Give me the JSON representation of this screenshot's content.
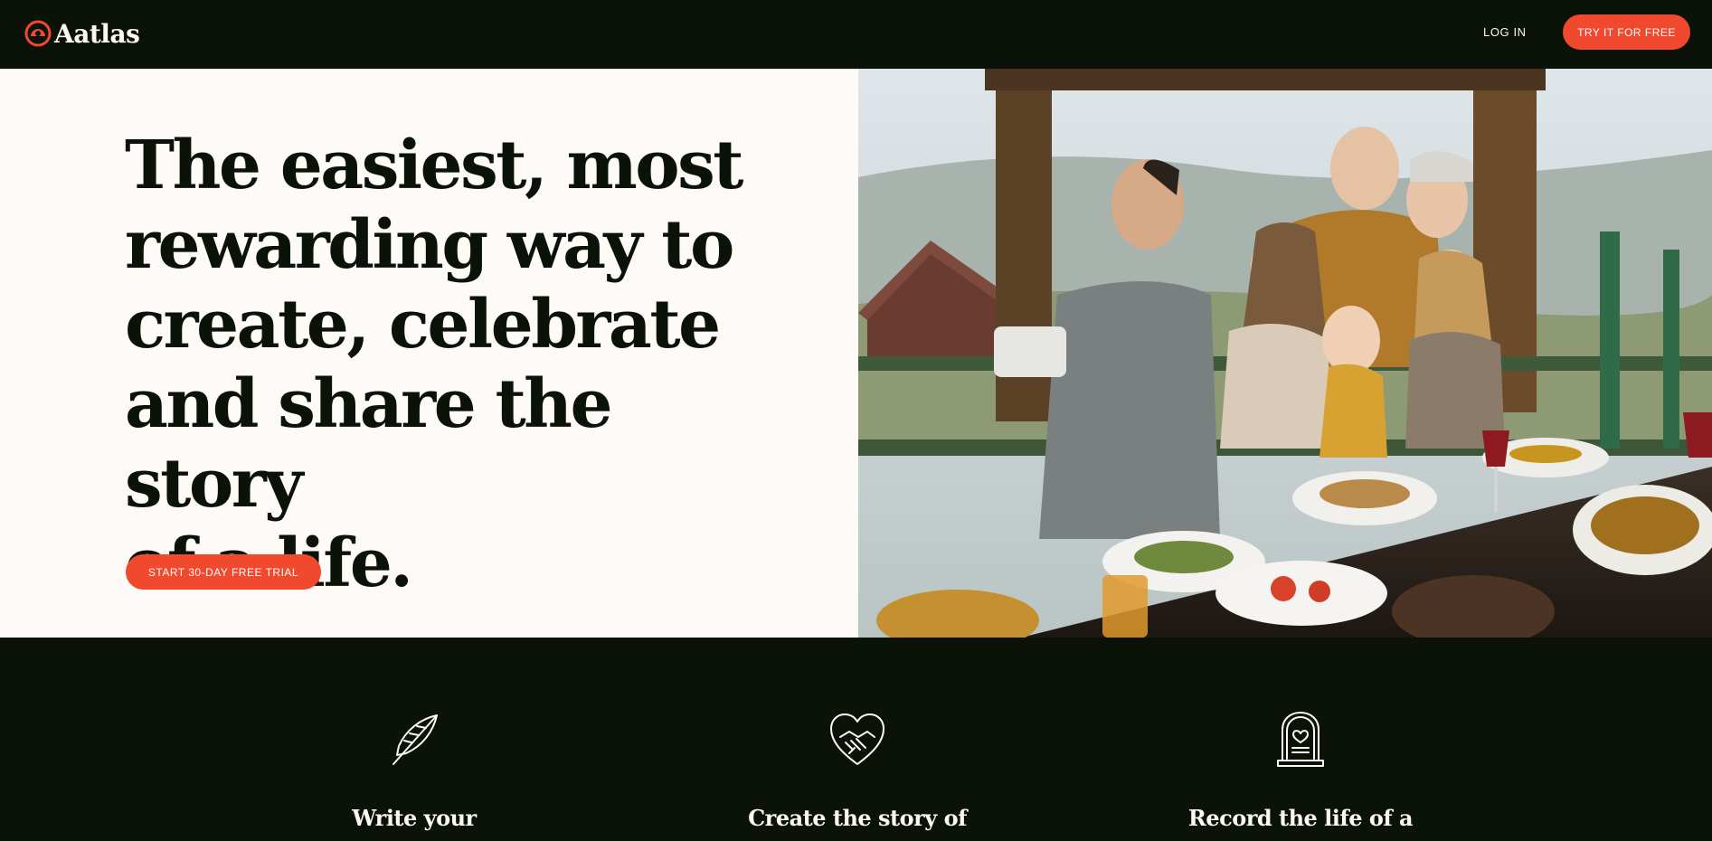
{
  "nav": {
    "brand": "Aatlas",
    "login_label": "LOG IN",
    "try_label": "TRY IT FOR FREE"
  },
  "hero": {
    "title": "The easiest, most\nrewarding way to\ncreate, celebrate\nand share the story\nof a life.",
    "cta_label": "START 30-DAY FREE TRIAL",
    "image_icon": "family-selfie-photo"
  },
  "features": [
    {
      "icon": "quill-feather-icon",
      "title": "Write your"
    },
    {
      "icon": "heart-handshake-icon",
      "title": "Create the story of"
    },
    {
      "icon": "headstone-heart-icon",
      "title": "Record the life of a"
    }
  ],
  "colors": {
    "dark": "#0b1208",
    "accent": "#f0492d",
    "cream": "#fdfaf8"
  }
}
